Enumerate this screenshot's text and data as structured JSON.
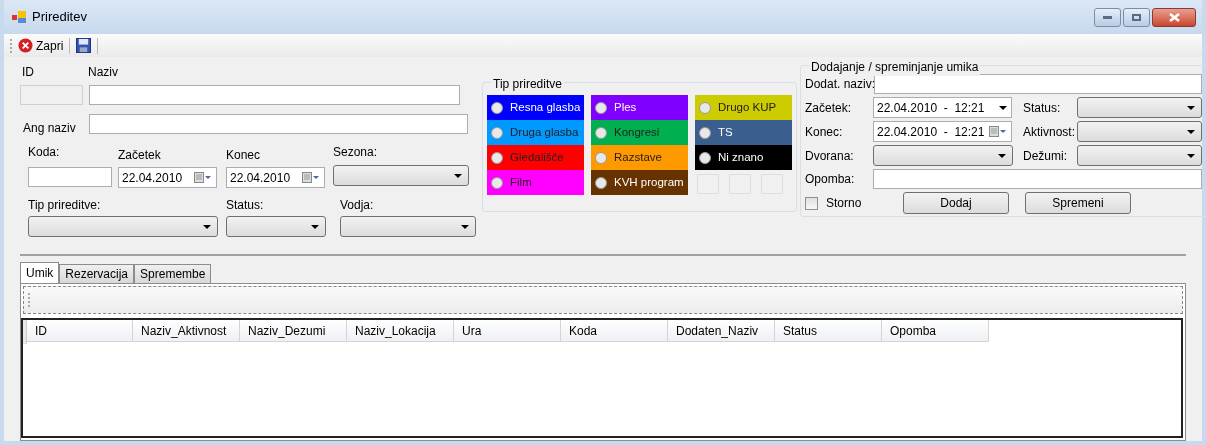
{
  "window": {
    "title": "Prireditev"
  },
  "toolbar": {
    "close_label": "Zapri"
  },
  "form": {
    "id_label": "ID",
    "naziv_label": "Naziv",
    "ang_naziv_label": "Ang naziv",
    "koda_label": "Koda:",
    "zacetek_label": "Začetek",
    "zacetek_value": "22.04.2010",
    "konec_label": "Konec",
    "konec_value": "22.04.2010",
    "sezona_label": "Sezona:",
    "tip_label": "Tip prireditve:",
    "status_label": "Status:",
    "vodja_label": "Vodja:",
    "id_disabled": true
  },
  "type_group": {
    "title": "Tip prireditve",
    "columns": [
      [
        {
          "label": "Resna glasba",
          "color": "#0000ff",
          "dark_text": false,
          "selected": false
        },
        {
          "label": "Druga glasba",
          "color": "#0099ff",
          "dark_text": true,
          "selected": false
        },
        {
          "label": "Gledališče",
          "color": "#ff0000",
          "dark_text": true,
          "selected": false
        },
        {
          "label": "Film",
          "color": "#ff00ff",
          "dark_text": true,
          "selected": false
        }
      ],
      [
        {
          "label": "Ples",
          "color": "#8000ff",
          "dark_text": false,
          "selected": false
        },
        {
          "label": "Kongresi",
          "color": "#00b050",
          "dark_text": true,
          "selected": false
        },
        {
          "label": "Razstave",
          "color": "#ff9900",
          "dark_text": true,
          "selected": false
        },
        {
          "label": "KVH program",
          "color": "#663300",
          "dark_text": false,
          "selected": false
        }
      ],
      [
        {
          "label": "Drugo KUP",
          "color": "#cccc00",
          "dark_text": true,
          "selected": false
        },
        {
          "label": "TS",
          "color": "#3a5f8f",
          "dark_text": false,
          "selected": false
        },
        {
          "label": "Ni znano",
          "color": "#000000",
          "dark_text": false,
          "selected": false
        }
      ]
    ]
  },
  "item_group": {
    "title": "Dodajanje / spreminjanje umika",
    "dodat_label": "Dodat. naziv:",
    "zacetek_label": "Začetek:",
    "zacetek_value": "22.04.2010  -  12:21",
    "konec_label": "Konec:",
    "konec_value": "22.04.2010  -  12:21",
    "dvorana_label": "Dvorana:",
    "status_label": "Status:",
    "aktivnost_label": "Aktivnost:",
    "dezumi_label": "Dežumi:",
    "opomba_label": "Opomba:",
    "storno_label": "Storno",
    "storno_checked": false,
    "add_button": "Dodaj",
    "save_button": "Spremeni"
  },
  "tabs": [
    {
      "label": "Umik",
      "selected": true
    },
    {
      "label": "Rezervacija",
      "selected": false
    },
    {
      "label": "Spremembe",
      "selected": false
    }
  ],
  "table": {
    "columns": [
      "ID",
      "Naziv_Aktivnost",
      "Naziv_Dezumi",
      "Naziv_Lokacija",
      "Ura",
      "Koda",
      "Dodaten_Naziv",
      "Status",
      "Opomba"
    ]
  }
}
